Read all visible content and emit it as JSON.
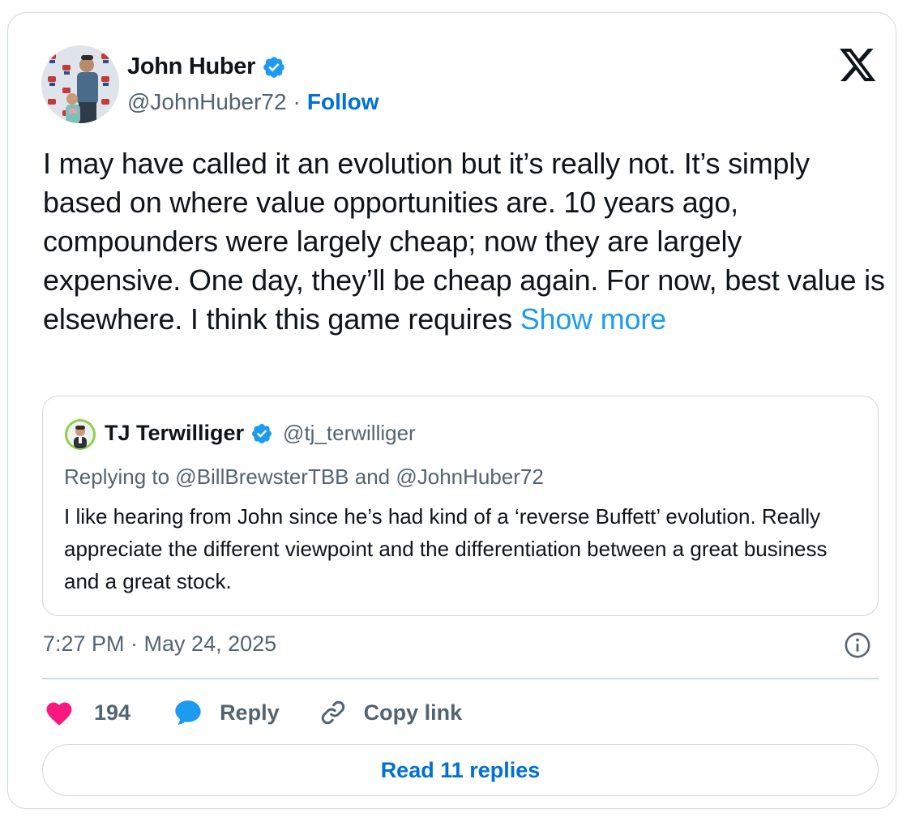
{
  "tweet": {
    "author_name": "John Huber",
    "author_handle": "@JohnHuber72",
    "separator": "·",
    "follow_label": "Follow",
    "body": "I may have called it an evolution but it’s really not. It’s simply based on where value opportunities are. 10 years ago, compounders were largely cheap; now they are largely expensive. One day, they’ll be cheap again. For now, best value is elsewhere. I think this game requires ",
    "show_more_label": "Show more",
    "timestamp": "7:27 PM · May 24, 2025"
  },
  "quote": {
    "author_name": "TJ Terwilliger",
    "author_handle": "@tj_terwilliger",
    "replying_to": "Replying to @BillBrewsterTBB and @JohnHuber72",
    "body": "I like hearing from John since he’s had kind of a ‘reverse Buffett’ evolution. Really appreciate the different viewpoint and the differentiation between a great business and a great stock."
  },
  "actions": {
    "like_count": "194",
    "reply_label": "Reply",
    "copy_link_label": "Copy link",
    "read_replies_label": "Read 11 replies"
  },
  "icons": {
    "verified": "verified-badge-icon",
    "x_logo": "x-logo-icon",
    "info": "info-icon",
    "like": "heart-icon",
    "reply": "speech-bubble-icon",
    "copy": "link-icon"
  },
  "colors": {
    "link_blue": "#006fd6",
    "show_more_blue": "#1d9bf0",
    "verified_blue": "#1d9bf0",
    "heart_pink": "#f91880",
    "text_primary": "#0f1419",
    "text_secondary": "#536471",
    "border": "#cfd9de"
  }
}
